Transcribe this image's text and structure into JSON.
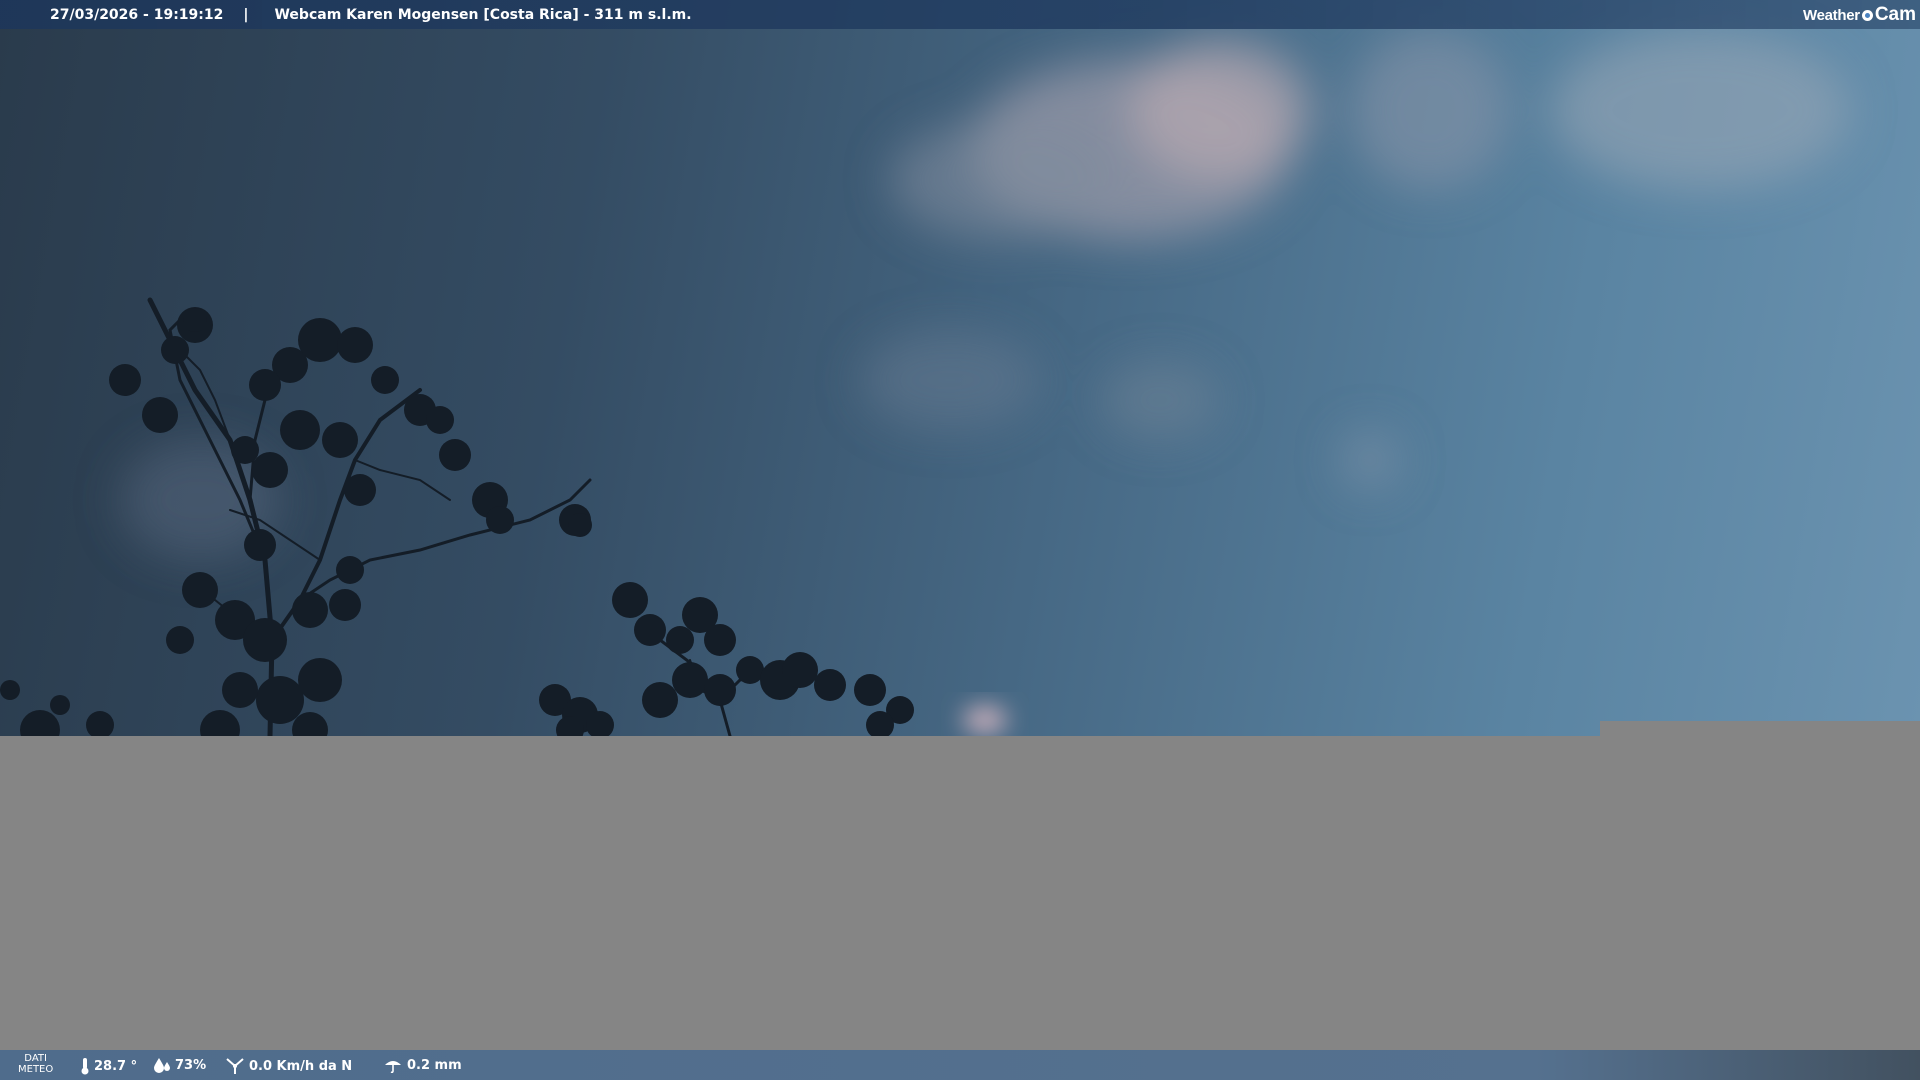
{
  "header": {
    "timestamp": "27/03/2026 - 19:19:12",
    "separator": "|",
    "title": "Webcam Karen Mogensen [Costa Rica]  - 311 m s.l.m."
  },
  "logo": {
    "weather": "Weather",
    "cam": "Cam"
  },
  "footer": {
    "dati_line1": "DATI",
    "dati_line2": "METEO",
    "temperature": "28.7 °",
    "humidity": "73%",
    "wind": "0.0 Km/h da N",
    "rain": "0.2 mm"
  },
  "colors": {
    "bar_bg": "#23406a",
    "footer_bg": "#54708e",
    "gray_block": "#858585",
    "logo_dot": "#4a82c0"
  },
  "icons": [
    "thermometer-icon",
    "humidity-icon",
    "wind-icon",
    "rain-icon"
  ]
}
